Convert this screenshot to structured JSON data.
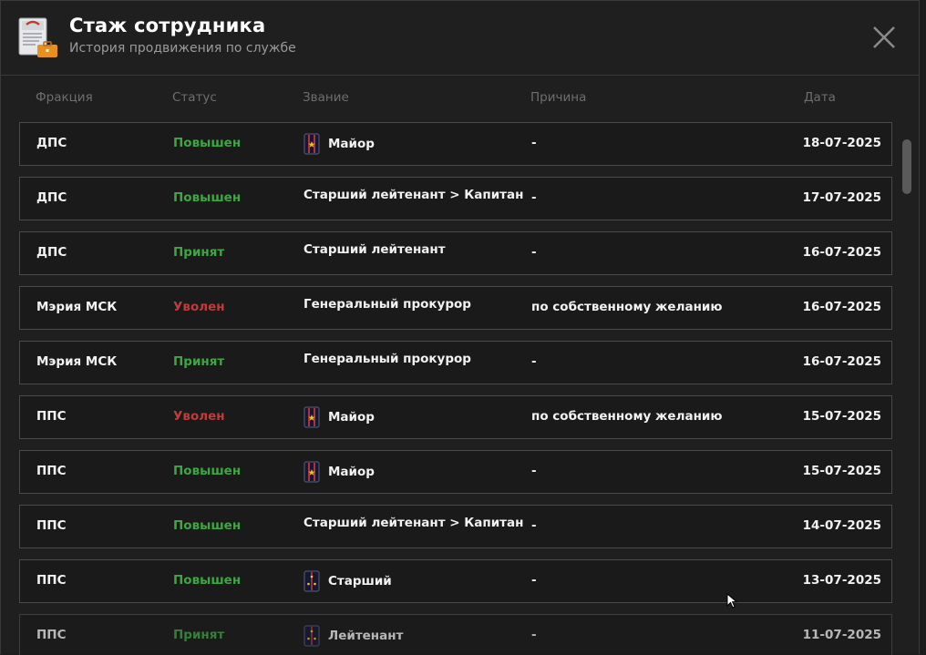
{
  "header": {
    "title": "Стаж сотрудника",
    "subtitle": "История продвижения по службе"
  },
  "columns": {
    "faction": "Фракция",
    "status": "Статус",
    "rank": "Звание",
    "reason": "Причина",
    "date": "Дата"
  },
  "colors": {
    "promoted": "#3ea642",
    "dismissed": "#c03b3b",
    "background": "#1f1f1f"
  },
  "rows": [
    {
      "faction": "ДПС",
      "status": "Повышен",
      "status_type": "green",
      "rank": "Майор",
      "rank_icon": "major-epaulet-icon",
      "reason": "-",
      "date": "18-07-2025"
    },
    {
      "faction": "ДПС",
      "status": "Повышен",
      "status_type": "green",
      "rank": "Старший лейтенант > Капитан",
      "rank_icon": "",
      "reason": "-",
      "date": "17-07-2025"
    },
    {
      "faction": "ДПС",
      "status": "Принят",
      "status_type": "green",
      "rank": "Старший лейтенант",
      "rank_icon": "",
      "reason": "-",
      "date": "16-07-2025"
    },
    {
      "faction": "Мэрия МСК",
      "status": "Уволен",
      "status_type": "red",
      "rank": "Генеральный прокурор",
      "rank_icon": "",
      "reason": "по собственному желанию",
      "date": "16-07-2025"
    },
    {
      "faction": "Мэрия МСК",
      "status": "Принят",
      "status_type": "green",
      "rank": "Генеральный прокурор",
      "rank_icon": "",
      "reason": "-",
      "date": "16-07-2025"
    },
    {
      "faction": "ППС",
      "status": "Уволен",
      "status_type": "red",
      "rank": "Майор",
      "rank_icon": "major-epaulet-icon",
      "reason": "по собственному желанию",
      "date": "15-07-2025"
    },
    {
      "faction": "ППС",
      "status": "Повышен",
      "status_type": "green",
      "rank": "Майор",
      "rank_icon": "major-epaulet-icon",
      "reason": "-",
      "date": "15-07-2025"
    },
    {
      "faction": "ППС",
      "status": "Повышен",
      "status_type": "green",
      "rank": "Старший лейтенант > Капитан",
      "rank_icon": "",
      "reason": "-",
      "date": "14-07-2025"
    },
    {
      "faction": "ППС",
      "status": "Повышен",
      "status_type": "green",
      "rank": "Старший",
      "rank_icon": "sergeant-epaulet-icon",
      "reason": "-",
      "date": "13-07-2025"
    },
    {
      "faction": "ППС",
      "status": "Принят",
      "status_type": "green",
      "rank": "Лейтенант",
      "rank_icon": "sergeant-epaulet-icon",
      "reason": "-",
      "date": "11-07-2025"
    }
  ]
}
